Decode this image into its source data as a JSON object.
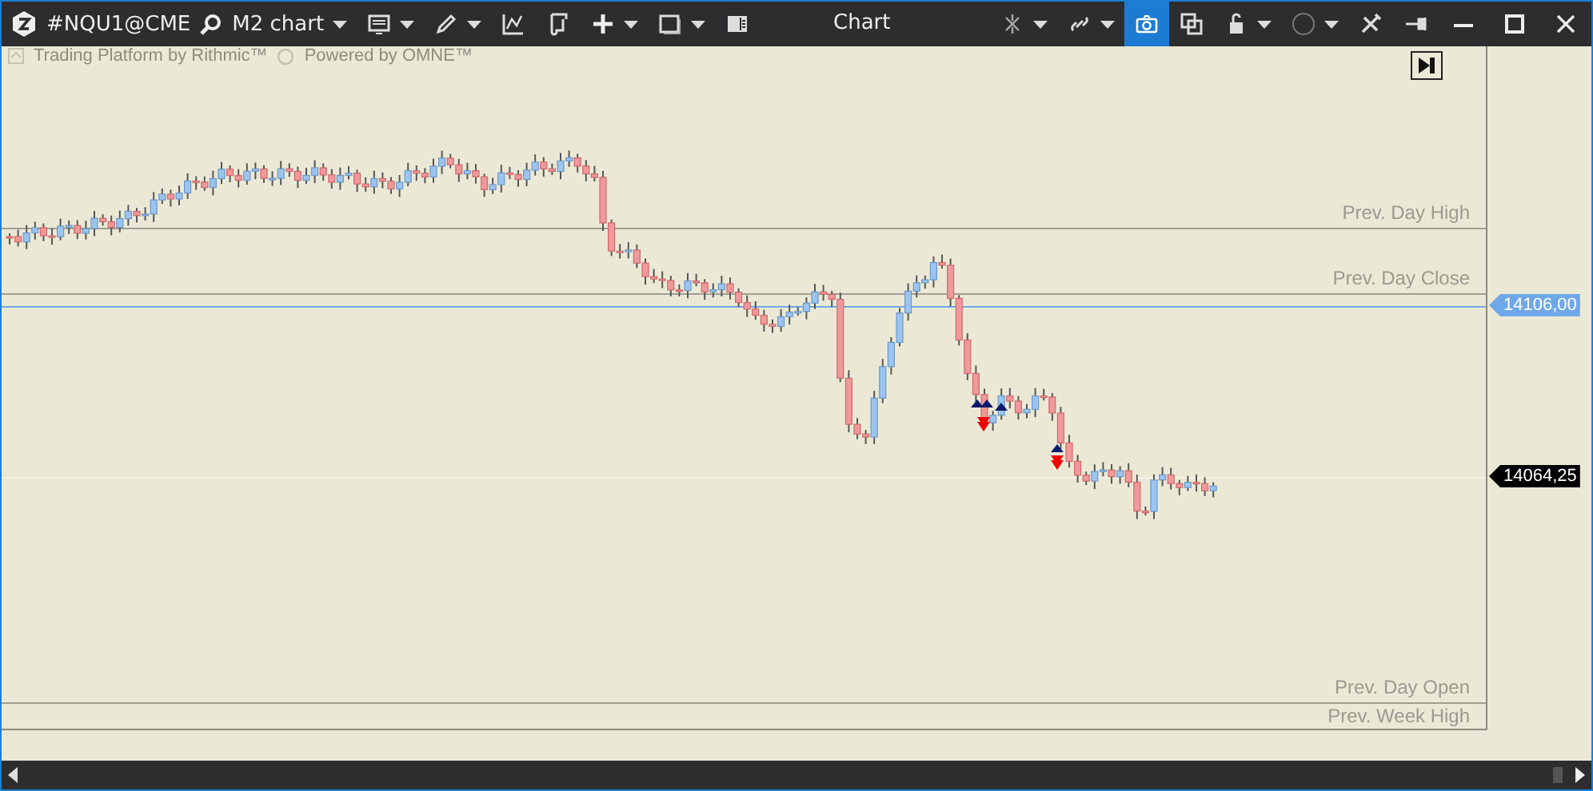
{
  "window": {
    "symbol": "#NQU1@CME",
    "timeframe": "M2 chart",
    "title": "Chart"
  },
  "left_tools": [
    {
      "kind": "monitor",
      "dropdown": true
    },
    {
      "kind": "pencil",
      "dropdown": true
    },
    {
      "kind": "indicator",
      "dropdown": false
    },
    {
      "kind": "script",
      "dropdown": false
    },
    {
      "kind": "plus",
      "dropdown": true
    },
    {
      "kind": "window",
      "dropdown": true
    },
    {
      "kind": "columns",
      "dropdown": false
    }
  ],
  "right_tools": [
    {
      "kind": "crosshair",
      "dropdown": true,
      "selected": false
    },
    {
      "kind": "link",
      "dropdown": true,
      "selected": false
    },
    {
      "kind": "camera",
      "dropdown": false,
      "selected": true
    },
    {
      "kind": "copy",
      "dropdown": false,
      "selected": false
    },
    {
      "kind": "lock",
      "dropdown": true,
      "selected": false
    },
    {
      "kind": "circle",
      "dropdown": true,
      "selected": false
    },
    {
      "kind": "tools",
      "dropdown": false,
      "selected": false
    },
    {
      "kind": "pin",
      "dropdown": false,
      "selected": false
    }
  ],
  "chart": {
    "branding": [
      "Trading Platform by Rithmic™",
      "Powered by OMNE™"
    ],
    "levels": [
      {
        "label": "Prev. Day High"
      },
      {
        "label": "Prev. Day Close"
      },
      {
        "label": "Prev. Day Open"
      },
      {
        "label": "Prev. Week High"
      }
    ],
    "price_labels": [
      {
        "text": "14106,00",
        "color": "#6fa8e8"
      },
      {
        "text": "14064,25",
        "color": "#000000"
      }
    ]
  }
}
